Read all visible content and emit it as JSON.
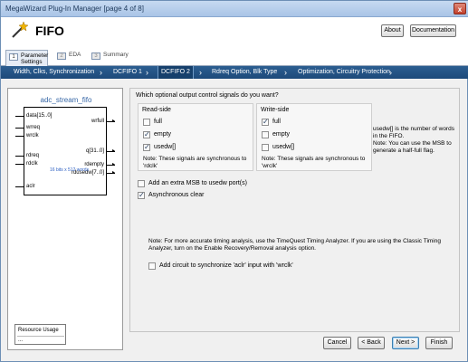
{
  "window": {
    "title": "MegaWizard Plug-In Manager [page 4 of 8]",
    "close_glyph": "x"
  },
  "header": {
    "title": "FIFO",
    "about_label": "About",
    "documentation_label": "Documentation",
    "icon": "magic-wand-icon"
  },
  "page_tabs": [
    {
      "num": "1",
      "label_line1": "Parameter",
      "label_line2": "Settings"
    },
    {
      "num": "2",
      "label_line1": "EDA",
      "label_line2": ""
    },
    {
      "num": "3",
      "label_line1": "Summary",
      "label_line2": ""
    }
  ],
  "breadcrumbs": [
    "Width, Clks, Synchronization",
    "DCFIFO 1",
    "DCFIFO 2",
    "Rdreq Option, Blk Type",
    "Optimization, Circuitry Protection"
  ],
  "diagram": {
    "title": "adc_stream_fifo",
    "left_pins": [
      "data[15..0]",
      "wrreq",
      "wrclk",
      "rdreq",
      "rdclk",
      "aclr"
    ],
    "right_pins": [
      "wrfull",
      "q[31..0]",
      "rdempty",
      "rdusedw[7..0]"
    ],
    "depth_note": "16 bits x 512 words"
  },
  "resource_usage": {
    "label": "Resource Usage",
    "value": "..."
  },
  "main": {
    "question": "Which optional output control signals do you want?",
    "read_side": {
      "heading": "Read-side",
      "options": [
        {
          "label": "full",
          "checked": false
        },
        {
          "label": "empty",
          "checked": true
        },
        {
          "label": "usedw[]",
          "checked": true
        }
      ],
      "note_line1": "Note: These signals are synchronous to",
      "note_line2": "'rdclk'"
    },
    "write_side": {
      "heading": "Write-side",
      "options": [
        {
          "label": "full",
          "checked": true
        },
        {
          "label": "empty",
          "checked": false
        },
        {
          "label": "usedw[]",
          "checked": false
        }
      ],
      "note_line1": "Note: These signals are synchronous to",
      "note_line2": "'wrclk'"
    },
    "usedw_info": "usedw[] is the number of words in the FIFO.",
    "msb_info": "Note: You can use the MSB to generate a half-full flag.",
    "extra_msb_label": "Add an extra MSB to usedw port(s)",
    "async_clear_label": "Asynchronous clear",
    "timing_note_line1": "Note: For more accurate timing analysis, use the TimeQuest Timing Analyzer. If you are using the Classic Timing",
    "timing_note_line2": "Analyzer, turn on the Enable Recovery/Removal analysis option.",
    "sync_aclr_label": "Add circuit to synchronize 'aclr' input with 'wrclk'"
  },
  "buttons": {
    "cancel": "Cancel",
    "back": "< Back",
    "next": "Next >",
    "finish": "Finish"
  }
}
